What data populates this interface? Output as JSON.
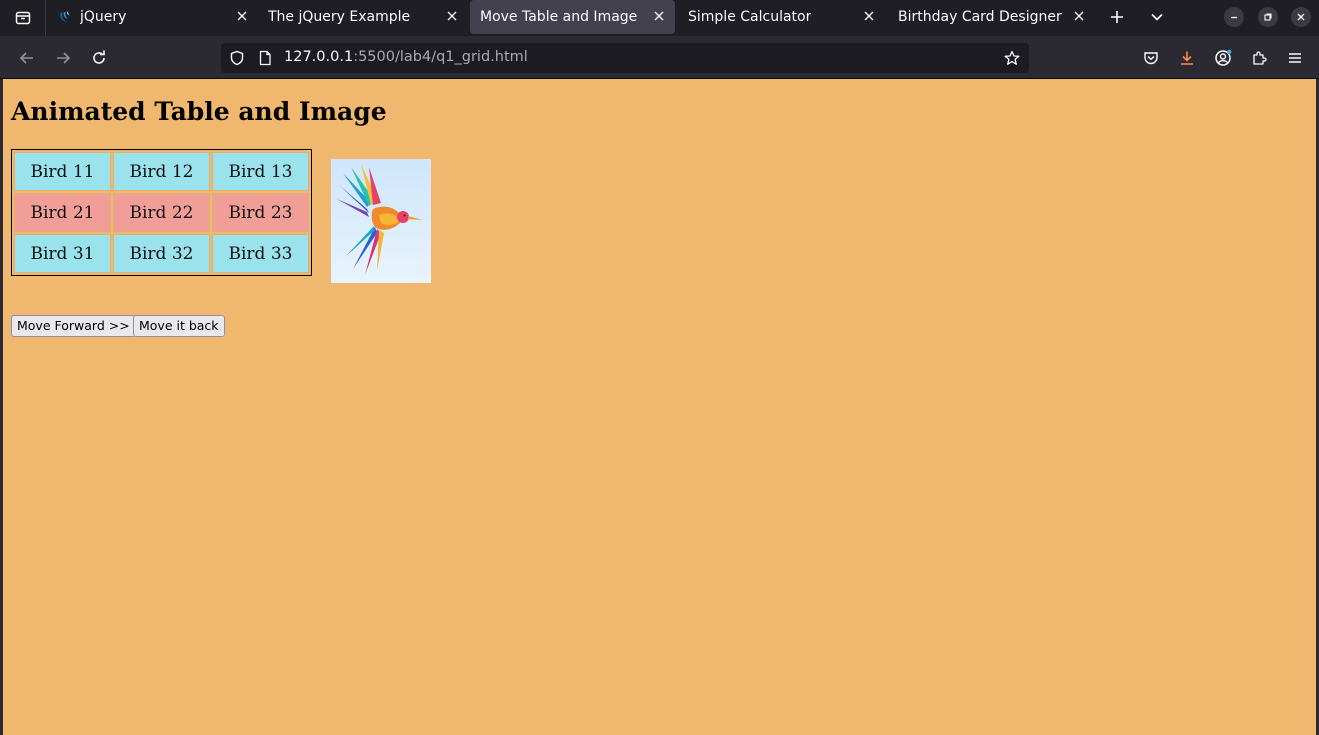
{
  "browser": {
    "tabs": [
      {
        "label": "jQuery",
        "icon": "jquery-icon",
        "active": false
      },
      {
        "label": "The jQuery Example",
        "icon": "",
        "active": false
      },
      {
        "label": "Move Table and Image",
        "icon": "",
        "active": true
      },
      {
        "label": "Simple Calculator",
        "icon": "",
        "active": false
      },
      {
        "label": "Birthday Card Designer",
        "icon": "",
        "active": false
      }
    ],
    "url": {
      "host": "127.0.0.1",
      "rest": ":5500/lab4/q1_grid.html"
    }
  },
  "page": {
    "title": "Animated Table and Image",
    "table": {
      "rows": [
        {
          "style": "cyan",
          "cells": [
            "Bird 11",
            "Bird 12",
            "Bird 13"
          ]
        },
        {
          "style": "pink",
          "cells": [
            "Bird 21",
            "Bird 22",
            "Bird 23"
          ]
        },
        {
          "style": "cyan",
          "cells": [
            "Bird 31",
            "Bird 32",
            "Bird 33"
          ]
        }
      ]
    },
    "image": {
      "icon": "hummingbird-image"
    },
    "buttons": {
      "forward": "Move Forward >>",
      "back": "Move it back"
    }
  },
  "colors": {
    "page_bg": "#f0b86e",
    "cyan_cell": "#9ae2ec",
    "pink_cell": "#f29e98",
    "download_accent": "#ff8a50"
  }
}
